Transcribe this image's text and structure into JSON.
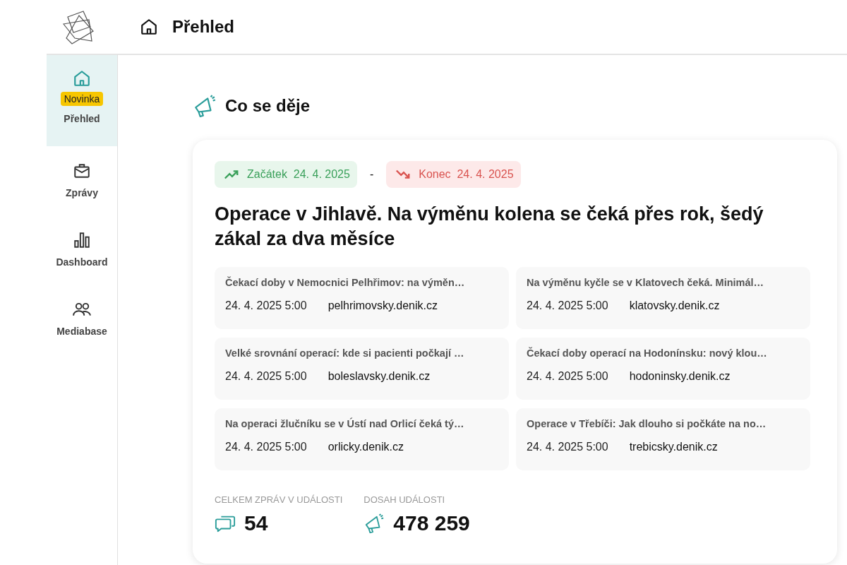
{
  "header": {
    "title": "Přehled"
  },
  "sidebar": {
    "items": [
      {
        "kind": "home",
        "label": "Přehled",
        "selected": true,
        "badge": "Novinka"
      },
      {
        "kind": "messages",
        "label": "Zprávy",
        "selected": false
      },
      {
        "kind": "dashboard",
        "label": "Dashboard",
        "selected": false
      },
      {
        "kind": "mediabase",
        "label": "Mediabase",
        "selected": false
      }
    ]
  },
  "section": {
    "title": "Co se děje"
  },
  "event": {
    "tags": [
      {
        "kind": "start",
        "label": "Začátek",
        "date": "24. 4. 2025"
      },
      {
        "kind": "end",
        "label": "Konec",
        "date": "24. 4. 2025"
      }
    ],
    "separator": "-",
    "title": "Operace v Jihlavě. Na výměnu kolena se čeká přes rok, šedý zákal za dva měsíce",
    "articles": [
      {
        "title": "Čekací doby v Nemocnici Pelhřimov: na výměn…",
        "time": "24. 4. 2025 5:00",
        "source": "pelhrimovsky.denik.cz"
      },
      {
        "title": "Na výměnu kyčle se v Klatovech čeká. Minimál…",
        "time": "24. 4. 2025 5:00",
        "source": "klatovsky.denik.cz"
      },
      {
        "title": "Velké srovnání operací: kde si pacienti počkají …",
        "time": "24. 4. 2025 5:00",
        "source": "boleslavsky.denik.cz"
      },
      {
        "title": "Čekací doby operací na Hodonínsku: nový klou…",
        "time": "24. 4. 2025 5:00",
        "source": "hodoninsky.denik.cz"
      },
      {
        "title": "Na operaci žlučníku se v Ústí nad Orlicí čeká tý…",
        "time": "24. 4. 2025 5:00",
        "source": "orlicky.denik.cz"
      },
      {
        "title": "Operace v Třebíči: Jak dlouho si počkáte na no…",
        "time": "24. 4. 2025 5:00",
        "source": "trebicsky.denik.cz"
      }
    ],
    "stats": [
      {
        "kind": "count",
        "label": "CELKEM ZPRÁV V UDÁLOSTI",
        "value": "54"
      },
      {
        "kind": "reach",
        "label": "DOSAH UDÁLOSTI",
        "value": "478 259"
      }
    ]
  }
}
